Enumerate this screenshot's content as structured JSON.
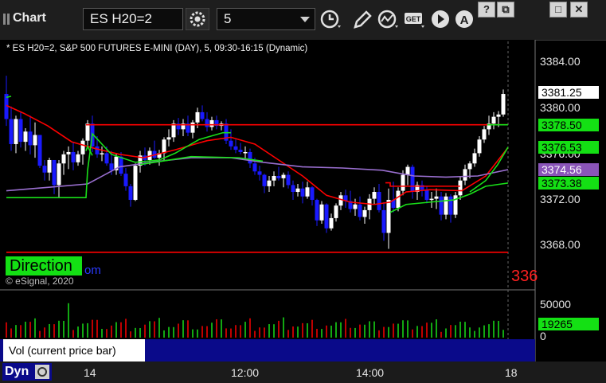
{
  "window": {
    "title": "Chart",
    "symbol_input": "ES H20=2",
    "interval_input": "5",
    "buttons": {
      "help": "?",
      "restore": "⧉",
      "maximize": "□",
      "close": "✕"
    }
  },
  "chart": {
    "symbol_line": "* ES H20=2, S&P 500 FUTURES E-MINI (DAY), 5, 09:30-16:15 (Dynamic)",
    "price_ticks": [
      "3384.00",
      "3380.00",
      "3376.00",
      "3372.00",
      "3368.00"
    ],
    "price_boxes": [
      {
        "label": "3381.25",
        "bg": "#ffffff",
        "fg": "#000000"
      },
      {
        "label": "3378.50",
        "bg": "#14e014",
        "fg": "#000000"
      },
      {
        "label": "3376.53",
        "bg": "#14e014",
        "fg": "#000000"
      },
      {
        "label": "3374.56",
        "bg": "#8a55b8",
        "fg": "#ffffff"
      },
      {
        "label": "3373.38",
        "bg": "#14e014",
        "fg": "#000000"
      }
    ],
    "direction_label": "Direction",
    "overlap_fragment": "om",
    "right_fragment": "336",
    "copyright": "© eSignal, 2020"
  },
  "volume": {
    "ticks": [
      "50000",
      "0"
    ],
    "current": "19265",
    "label": "Vol (current price bar)",
    "close_glyph": "×"
  },
  "time_axis": {
    "labels": [
      "14",
      "12:00",
      "14:00",
      "18"
    ]
  },
  "bottom": {
    "tab_label": "Dyn"
  },
  "colors": {
    "up_candle": "#ffffff",
    "down_candle": "#1a1aff",
    "red_line": "#ff0000",
    "green_line": "#19e019",
    "purple_line": "#9a6fd0",
    "vol_panel": "#0a0a8a"
  }
}
